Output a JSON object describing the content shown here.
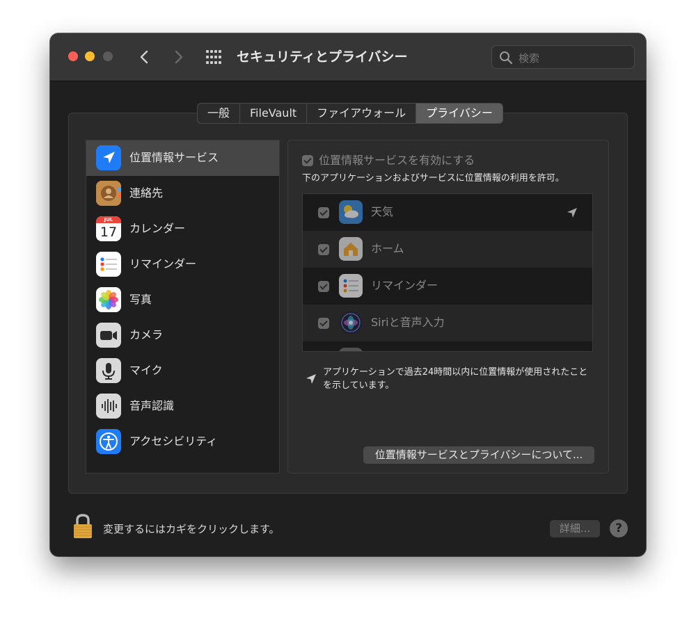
{
  "window": {
    "title": "セキュリティとプライバシー",
    "search_placeholder": "検索"
  },
  "tabs": [
    {
      "label": "一般",
      "active": false
    },
    {
      "label": "FileVault",
      "active": false
    },
    {
      "label": "ファイアウォール",
      "active": false
    },
    {
      "label": "プライバシー",
      "active": true
    }
  ],
  "sidebar": {
    "selected_index": 0,
    "items": [
      {
        "label": "位置情報サービス",
        "icon": "location-arrow-icon"
      },
      {
        "label": "連絡先",
        "icon": "contacts-icon"
      },
      {
        "label": "カレンダー",
        "icon": "calendar-icon",
        "icon_month": "JUL",
        "icon_day": "17"
      },
      {
        "label": "リマインダー",
        "icon": "reminders-icon"
      },
      {
        "label": "写真",
        "icon": "photos-icon"
      },
      {
        "label": "カメラ",
        "icon": "camera-icon"
      },
      {
        "label": "マイク",
        "icon": "microphone-icon"
      },
      {
        "label": "音声認識",
        "icon": "speech-recognition-icon"
      },
      {
        "label": "アクセシビリティ",
        "icon": "accessibility-icon"
      }
    ]
  },
  "panel": {
    "enable_label": "位置情報サービスを有効にする",
    "enable_checked": true,
    "subtitle": "下のアプリケーションおよびサービスに位置情報の利用を許可。",
    "apps": [
      {
        "name": "天気",
        "checked": true,
        "icon": "weather-icon",
        "recent_use": true
      },
      {
        "name": "ホーム",
        "checked": true,
        "icon": "home-icon",
        "recent_use": false
      },
      {
        "name": "リマインダー",
        "checked": true,
        "icon": "reminders-icon",
        "recent_use": false
      },
      {
        "name": "Siriと音声入力",
        "checked": true,
        "icon": "siri-icon",
        "recent_use": false
      }
    ],
    "note": "アプリケーションで過去24時間以内に位置情報が使用されたことを示しています。",
    "about_button": "位置情報サービスとプライバシーについて..."
  },
  "footer": {
    "lock_text": "変更するにはカギをクリックします。",
    "detail_button": "詳細...",
    "help_label": "?"
  },
  "colors": {
    "close": "#ff5f57",
    "minimize": "#febc2e",
    "accent_blue": "#1f7cf6"
  }
}
